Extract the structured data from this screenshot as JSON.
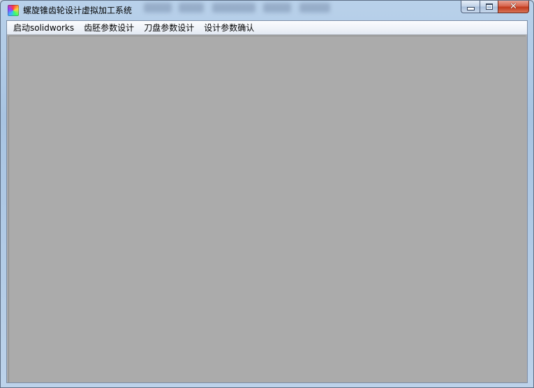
{
  "window": {
    "title": "螺旋锥齿轮设计虚拟加工系统",
    "icon": "app-color-icon",
    "caption": {
      "minimize_icon": "minimize-icon",
      "maximize_icon": "maximize-icon",
      "close_icon": "close-icon",
      "close_glyph": "✕"
    }
  },
  "menubar": {
    "items": [
      {
        "label": "启动solidworks"
      },
      {
        "label": "齿胚参数设计"
      },
      {
        "label": "刀盘参数设计"
      },
      {
        "label": "设计参数确认"
      }
    ]
  },
  "colors": {
    "mdi_background": "#ababab",
    "close_button": "#c13a1d",
    "frame": "#b9d1ea"
  }
}
